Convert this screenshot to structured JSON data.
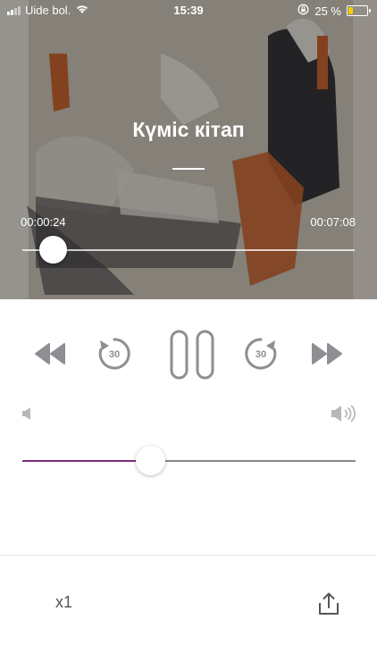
{
  "status_bar": {
    "carrier": "Uide bol.",
    "time": "15:39",
    "battery": "25 %"
  },
  "player": {
    "title": "Күміс кітап",
    "elapsed": "00:00:24",
    "duration": "00:07:08",
    "progress_fraction": 0.056,
    "volume_fraction": 0.39
  },
  "controls": {
    "rewind_seconds": "30",
    "forward_seconds": "30",
    "speed": "x1"
  },
  "icons": [
    "rewind-icon",
    "skip-back-30-icon",
    "pause-icon",
    "skip-forward-30-icon",
    "fast-forward-icon",
    "volume-low-icon",
    "volume-high-icon",
    "share-icon",
    "wifi-icon",
    "signal-icon",
    "lock-rotation-icon",
    "battery-icon"
  ],
  "colors": {
    "volume_fill": "#7b2a7a",
    "icon_gray": "#8e8e93",
    "battery": "#f5d000"
  }
}
